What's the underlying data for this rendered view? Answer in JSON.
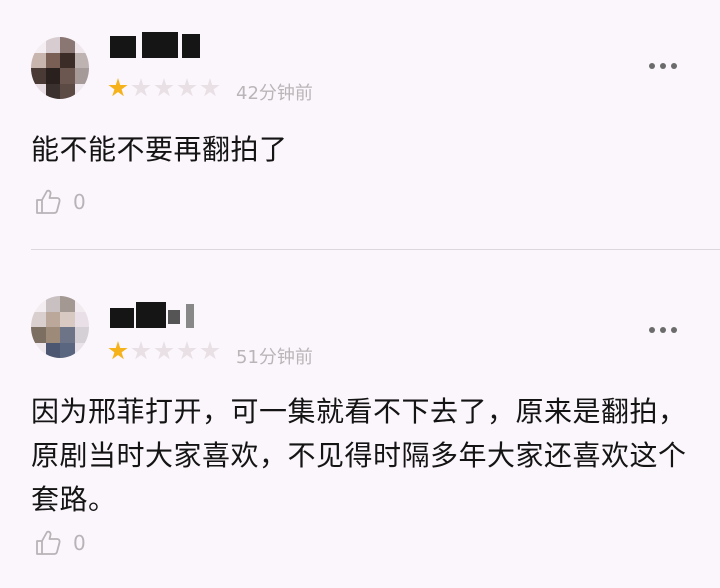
{
  "comments": [
    {
      "username": "█████",
      "rating_stars": 1,
      "rating_max": 5,
      "time": "42分钟前",
      "text": "能不能不要再翻拍了",
      "likes": "0"
    },
    {
      "username": "████",
      "rating_stars": 1,
      "rating_max": 5,
      "time": "51分钟前",
      "text": "因为邢菲打开，可一集就看不下去了，原来是翻拍，原剧当时大家喜欢，不见得时隔多年大家还喜欢这个套路。",
      "likes": "0"
    }
  ],
  "icons": {
    "more": "more-dots-icon",
    "like": "thumbs-up-icon",
    "star": "star-icon"
  },
  "colors": {
    "background": "#fbf6fb",
    "star_active": "#f6b21a",
    "star_inactive": "#e8e0e5",
    "muted_text": "#b9b5b8",
    "body_text": "#141414"
  }
}
